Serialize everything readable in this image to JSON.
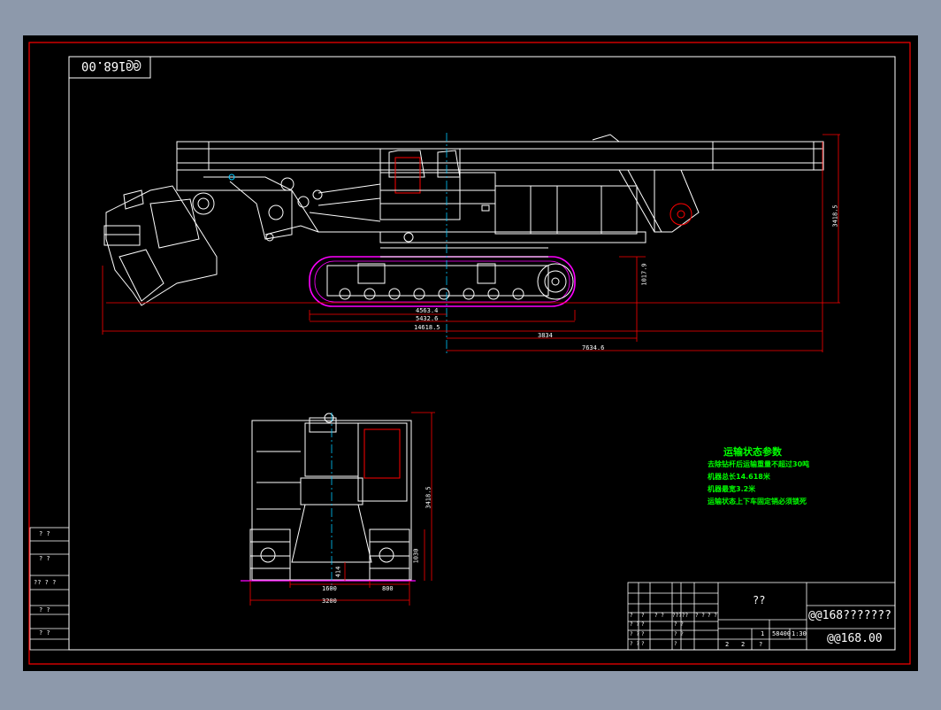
{
  "drawing": {
    "code_mirrored": "@@168.00",
    "code_title": "@@168.00",
    "title_main": "@@168???????",
    "title_box_center": "??"
  },
  "notes": {
    "heading": "运输状态参数",
    "lines": [
      "去除钻杆后运输重量不超过30吨",
      "机器总长14.618米",
      "机器最宽3.2米",
      "运输状态上下车固定销必须锁死"
    ]
  },
  "side_dims": {
    "d1": "4563.4",
    "d2": "5432.6",
    "d3": "14618.5",
    "d4": "3834",
    "d5": "7634.6",
    "h1": "3418.5",
    "h2": "1017.9"
  },
  "front_dims": {
    "w1": "1600",
    "w2": "800",
    "w3": "3200",
    "h1": "3418.5",
    "h2": "1030",
    "h3": "414"
  },
  "left_strip": [
    "? ?",
    "? ?",
    "?? ? ?",
    "? ?",
    "? ?"
  ],
  "title_block": {
    "row_a": [
      "?",
      "?",
      "? ?",
      "? ?",
      "?????",
      "? ?",
      "? ?"
    ],
    "row_b": [
      "? ?",
      "?",
      "? ?",
      "?",
      "?"
    ],
    "row_c": [
      "? ?",
      "?",
      "? ?"
    ],
    "row_d": [
      "? ?",
      "?",
      "?",
      "2",
      "2",
      "?"
    ],
    "scale_cells": [
      "1",
      "58400",
      "1:30"
    ]
  },
  "colors": {
    "background": "#8d99ab",
    "paper": "#000000",
    "outer_frame": "#ff0000",
    "drawing_lines": "#ffffff",
    "tracks": "#ff00ff",
    "dimension_lines": "#ff0000",
    "notes_text": "#00ff00",
    "highlight_parts": "#ff0000",
    "hidden_axis": "#00c8ff"
  }
}
